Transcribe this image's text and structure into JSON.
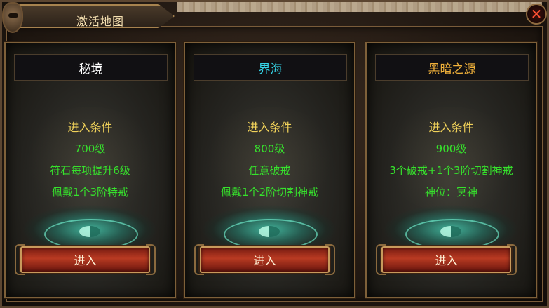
{
  "window": {
    "title": "激活地图"
  },
  "colors": {
    "title_gold": "#f4dfb0",
    "req_head": "#f1d25a",
    "req_line": "#36e22c",
    "card1_title": "#ffffff",
    "card2_title": "#35d5e8",
    "card3_title": "#f0b13a"
  },
  "cards": [
    {
      "title": "秘境",
      "requirement_head": "进入条件",
      "lines": [
        "700级",
        "符石每项提升6级",
        "佩戴1个3阶特戒"
      ],
      "button": "进入"
    },
    {
      "title": "界海",
      "requirement_head": "进入条件",
      "lines": [
        "800级",
        "任意破戒",
        "佩戴1个2阶切割神戒"
      ],
      "button": "进入"
    },
    {
      "title": "黑暗之源",
      "requirement_head": "进入条件",
      "lines": [
        "900级",
        "3个破戒+1个3阶切割神戒",
        "神位：冥神"
      ],
      "button": "进入"
    }
  ],
  "icons": {
    "close": "close-icon",
    "skull": "skull-ornament-icon"
  }
}
